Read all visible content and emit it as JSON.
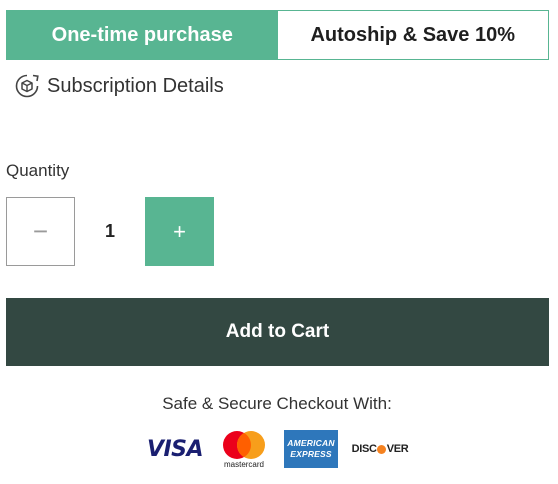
{
  "purchase_options": {
    "one_time": "One-time purchase",
    "autoship": "Autoship & Save 10%"
  },
  "subscription": {
    "label": "Subscription Details"
  },
  "quantity": {
    "label": "Quantity",
    "value": "1",
    "minus": "−",
    "plus": "+"
  },
  "cart": {
    "button_label": "Add to Cart"
  },
  "checkout": {
    "secure_text": "Safe & Secure Checkout With:",
    "cards": {
      "visa": "VISA",
      "mastercard": "mastercard",
      "amex_line1": "AMERICAN",
      "amex_line2": "EXPRESS",
      "discover_a": "DISC",
      "discover_b": "VER"
    }
  },
  "colors": {
    "accent": "#58b592",
    "dark": "#334842"
  }
}
